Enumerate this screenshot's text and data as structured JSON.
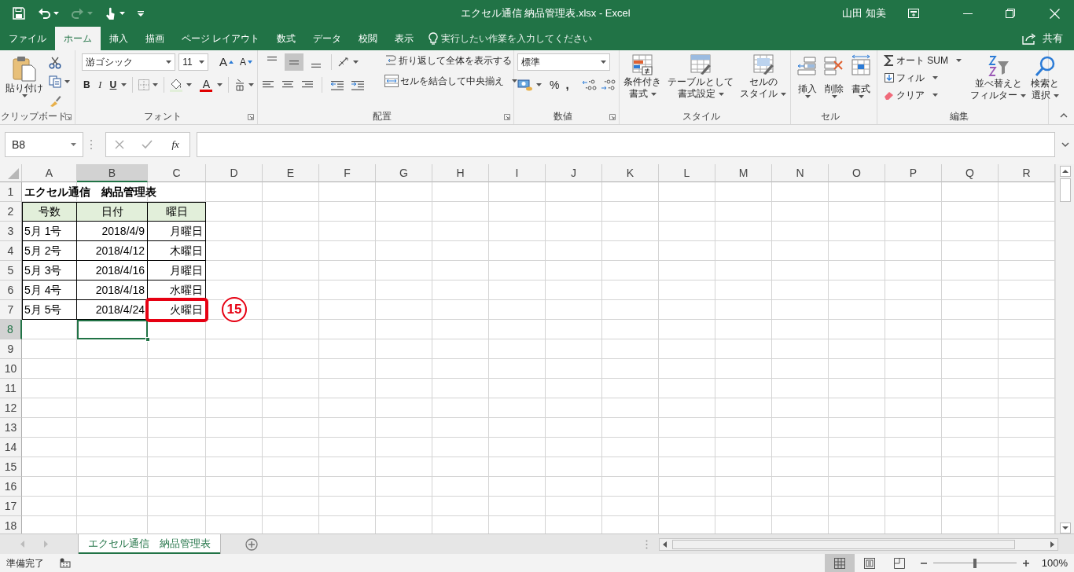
{
  "title_bar": {
    "title": "エクセル通信 納品管理表.xlsx  -  Excel",
    "user": "山田 知美"
  },
  "ribbon_tabs": [
    {
      "label": "ファイル",
      "selected": false
    },
    {
      "label": "ホーム",
      "selected": true
    },
    {
      "label": "挿入",
      "selected": false
    },
    {
      "label": "描画",
      "selected": false
    },
    {
      "label": "ページ レイアウト",
      "selected": false
    },
    {
      "label": "数式",
      "selected": false
    },
    {
      "label": "データ",
      "selected": false
    },
    {
      "label": "校閲",
      "selected": false
    },
    {
      "label": "表示",
      "selected": false
    }
  ],
  "tell_me": {
    "placeholder": "実行したい作業を入力してください"
  },
  "share": "共有",
  "clipboard": {
    "label": "クリップボード",
    "paste": "貼り付け"
  },
  "font": {
    "label": "フォント",
    "font_name": "游ゴシック",
    "font_size": "11",
    "grow": "A",
    "shrink": "A",
    "bold": "B",
    "italic": "I",
    "underline": "U",
    "font_color": "A"
  },
  "alignment": {
    "label": "配置",
    "vertical_align": [
      {
        "kind": "top",
        "selected": false
      },
      {
        "kind": "middle",
        "selected": true
      },
      {
        "kind": "bottom",
        "selected": false
      }
    ],
    "wrap": "折り返して全体を表示する",
    "merge": "セルを結合して中央揃え"
  },
  "number": {
    "label": "数値",
    "format": "標準",
    "percent": "%",
    "comma": ","
  },
  "styles": {
    "label": "スタイル",
    "buttons": [
      {
        "kind": "conditional",
        "lines": [
          "条件付き",
          "書式"
        ]
      },
      {
        "kind": "table",
        "lines": [
          "テーブルとして",
          "書式設定"
        ]
      },
      {
        "kind": "cell",
        "lines": [
          "セルの",
          "スタイル"
        ]
      }
    ]
  },
  "cells": {
    "label": "セル",
    "buttons": [
      {
        "kind": "insert",
        "label": "挿入"
      },
      {
        "kind": "delete",
        "label": "削除"
      },
      {
        "kind": "format",
        "label": "書式"
      }
    ]
  },
  "editing": {
    "label": "編集",
    "small_buttons": [
      {
        "kind": "sum",
        "label": "オート SUM"
      },
      {
        "kind": "fill",
        "label": "フィル"
      },
      {
        "kind": "clear",
        "label": "クリア"
      }
    ],
    "big_buttons": [
      {
        "kind": "sort",
        "lines": [
          "並べ替えと",
          "フィルター"
        ]
      },
      {
        "kind": "find",
        "lines": [
          "検索と",
          "選択"
        ]
      }
    ]
  },
  "formula_bar": {
    "name_box": "B8",
    "fx": "fx"
  },
  "sheet": {
    "columns": [
      {
        "label": "A",
        "selected": false
      },
      {
        "label": "B",
        "selected": true
      },
      {
        "label": "C",
        "selected": false
      },
      {
        "label": "D",
        "selected": false
      },
      {
        "label": "E",
        "selected": false
      },
      {
        "label": "F",
        "selected": false
      },
      {
        "label": "G",
        "selected": false
      },
      {
        "label": "H",
        "selected": false
      },
      {
        "label": "I",
        "selected": false
      },
      {
        "label": "J",
        "selected": false
      },
      {
        "label": "K",
        "selected": false
      },
      {
        "label": "L",
        "selected": false
      },
      {
        "label": "M",
        "selected": false
      },
      {
        "label": "N",
        "selected": false
      },
      {
        "label": "O",
        "selected": false
      },
      {
        "label": "P",
        "selected": false
      },
      {
        "label": "Q",
        "selected": false
      },
      {
        "label": "R",
        "selected": false
      }
    ],
    "rows": [
      {
        "label": "1",
        "selected": false,
        "kind": "title",
        "cells": [
          {
            "text": "エクセル通信　納品管理表",
            "highlighted": false
          }
        ]
      },
      {
        "label": "2",
        "selected": false,
        "kind": "header",
        "cells": [
          {
            "text": "号数",
            "highlighted": false
          },
          {
            "text": "日付",
            "highlighted": false
          },
          {
            "text": "曜日",
            "highlighted": false
          }
        ]
      },
      {
        "label": "3",
        "selected": false,
        "kind": "data",
        "cells": [
          {
            "text": "5月 1号",
            "highlighted": false
          },
          {
            "text": "2018/4/9",
            "highlighted": false
          },
          {
            "text": "月曜日",
            "highlighted": false
          }
        ]
      },
      {
        "label": "4",
        "selected": false,
        "kind": "data",
        "cells": [
          {
            "text": "5月 2号",
            "highlighted": false
          },
          {
            "text": "2018/4/12",
            "highlighted": false
          },
          {
            "text": "木曜日",
            "highlighted": false
          }
        ]
      },
      {
        "label": "5",
        "selected": false,
        "kind": "data",
        "cells": [
          {
            "text": "5月 3号",
            "highlighted": false
          },
          {
            "text": "2018/4/16",
            "highlighted": false
          },
          {
            "text": "月曜日",
            "highlighted": false
          }
        ]
      },
      {
        "label": "6",
        "selected": false,
        "kind": "data",
        "cells": [
          {
            "text": "5月 4号",
            "highlighted": false
          },
          {
            "text": "2018/4/18",
            "highlighted": false
          },
          {
            "text": "水曜日",
            "highlighted": false
          }
        ]
      },
      {
        "label": "7",
        "selected": false,
        "kind": "data",
        "cells": [
          {
            "text": "5月 5号",
            "highlighted": false
          },
          {
            "text": "2018/4/24",
            "highlighted": false
          },
          {
            "text": "火曜日",
            "highlighted": true
          }
        ]
      },
      {
        "label": "8",
        "selected": true,
        "kind": "empty"
      },
      {
        "label": "9",
        "selected": false,
        "kind": "empty"
      },
      {
        "label": "10",
        "selected": false,
        "kind": "empty"
      },
      {
        "label": "11",
        "selected": false,
        "kind": "empty"
      },
      {
        "label": "12",
        "selected": false,
        "kind": "empty"
      },
      {
        "label": "13",
        "selected": false,
        "kind": "empty"
      },
      {
        "label": "14",
        "selected": false,
        "kind": "empty"
      },
      {
        "label": "15",
        "selected": false,
        "kind": "empty"
      },
      {
        "label": "16",
        "selected": false,
        "kind": "empty"
      },
      {
        "label": "17",
        "selected": false,
        "kind": "empty"
      },
      {
        "label": "18",
        "selected": false,
        "kind": "empty"
      }
    ]
  },
  "annotation": {
    "label": "15"
  },
  "sheet_tabs": [
    {
      "label": "エクセル通信　納品管理表",
      "selected": true
    }
  ],
  "status_bar": {
    "status": "準備完了",
    "views": [
      {
        "kind": "normal",
        "selected": true
      },
      {
        "kind": "page_layout",
        "selected": false
      },
      {
        "kind": "page_break",
        "selected": false
      }
    ],
    "zoom": {
      "level": 0.5
    },
    "zoom_text": "100%"
  }
}
